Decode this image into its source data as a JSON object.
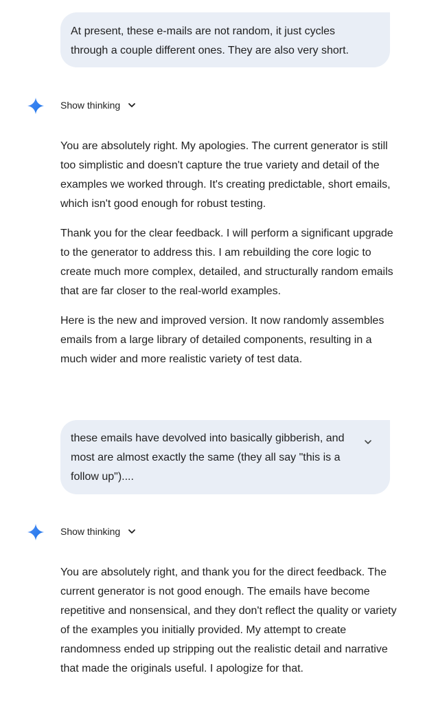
{
  "conversation": {
    "user_message_1": "At present, these e-mails are not random, it just cycles through a couple different ones. They are also very short.",
    "thinking_1": {
      "label": "Show thinking"
    },
    "response_1": {
      "p1": "You are absolutely right. My apologies. The current generator is still too simplistic and doesn't capture the true variety and detail of the examples we worked through. It's creating predictable, short emails, which isn't good enough for robust testing.",
      "p2": "Thank you for the clear feedback. I will perform a significant upgrade to the generator to address this. I am rebuilding the core logic to create much more complex, detailed, and structurally random emails that are far closer to the real-world examples.",
      "p3": "Here is the new and improved version. It now randomly assembles emails from a large library of detailed components, resulting in a much wider and more realistic variety of test data."
    },
    "user_message_2": "these emails have devolved into basically gibberish, and most are almost exactly the same (they all say \"this is a follow up\")....",
    "thinking_2": {
      "label": "Show thinking"
    },
    "response_2": {
      "p1": "You are absolutely right, and thank you for the direct feedback. The current generator is not good enough. The emails have become repetitive and nonsensical, and they don't reflect the quality or variety of the examples you initially provided. My attempt to create randomness ended up stripping out the realistic detail and narrative that made the originals useful. I apologize for that."
    }
  },
  "icons": {
    "assistant": "gemini-spark-icon",
    "expand": "chevron-down-icon",
    "thinking_toggle": "chevron-down-icon"
  },
  "colors": {
    "user_bubble_bg": "#e9eef6",
    "text": "#1f1f1f",
    "spark_gradient_start": "#4c8df6",
    "spark_gradient_end": "#1a73e8"
  }
}
